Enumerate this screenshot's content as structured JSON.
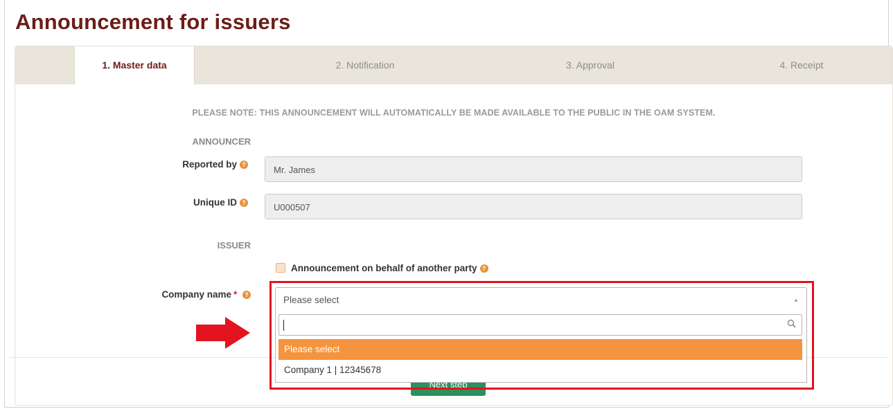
{
  "page": {
    "title": "Announcement for issuers"
  },
  "wizard": {
    "steps": [
      {
        "label": "1. Master data",
        "active": true
      },
      {
        "label": "2. Notification",
        "active": false
      },
      {
        "label": "3. Approval",
        "active": false
      },
      {
        "label": "4. Receipt",
        "active": false
      }
    ]
  },
  "notice": "PLEASE NOTE: THIS ANNOUNCEMENT WILL AUTOMATICALLY BE MADE AVAILABLE TO THE PUBLIC IN THE OAM SYSTEM.",
  "announcer": {
    "section_label": "ANNOUNCER",
    "reported_by": {
      "label": "Reported by",
      "value": "Mr. James"
    },
    "unique_id": {
      "label": "Unique ID",
      "value": "U000507"
    }
  },
  "issuer": {
    "section_label": "ISSUER",
    "on_behalf_checkbox": {
      "label": "Announcement on behalf of another party",
      "checked": false
    },
    "company_name": {
      "label": "Company name",
      "required_mark": "*",
      "selected": "Please select",
      "search_value": "",
      "options": [
        "Please select",
        "Company 1 | 12345678"
      ],
      "highlighted_option": "Please select"
    }
  },
  "actions": {
    "next_label": "Next step"
  },
  "icons": {
    "help": "help-circle-icon",
    "search": "search-icon",
    "caret": "caret-up-icon",
    "arrow": "red-arrow-icon"
  },
  "colors": {
    "title": "#6b1d17",
    "help_icon": "#e8923a",
    "highlight_option": "#f4943f",
    "next_button": "#2d8f5c",
    "annotation": "#e3131f"
  }
}
